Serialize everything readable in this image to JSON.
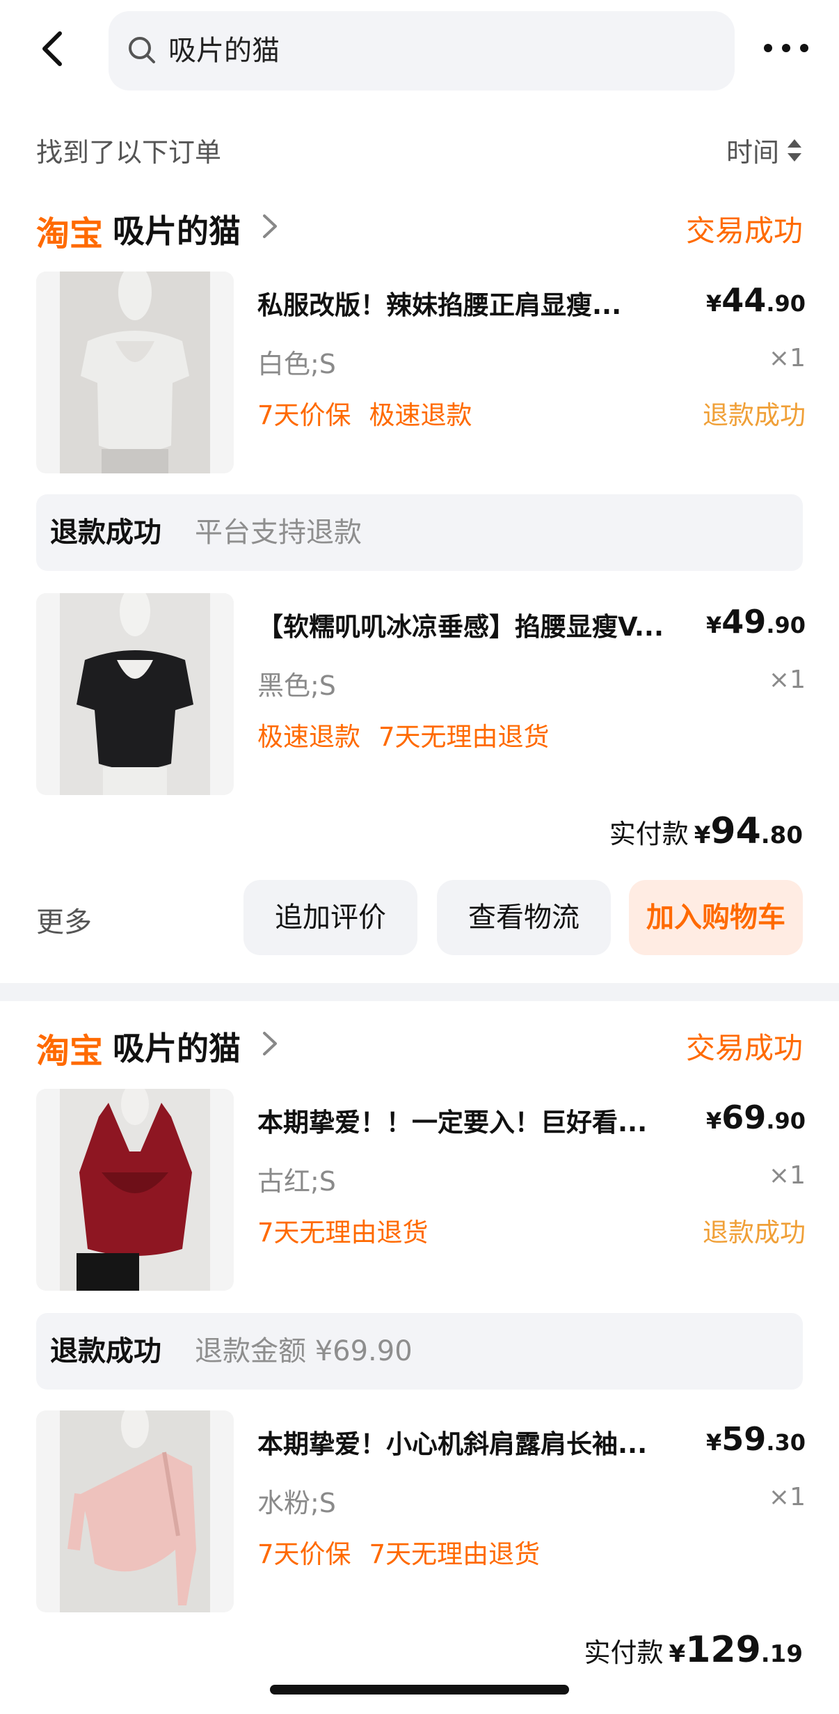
{
  "search": {
    "query": "吸片的猫"
  },
  "list": {
    "found_label": "找到了以下订单",
    "sort_label": "时间"
  },
  "orders": [
    {
      "platform": "淘宝",
      "shop": "吸片的猫",
      "status": "交易成功",
      "items": [
        {
          "title": "私服改版！辣妹掐腰正肩显瘦...",
          "price_cur": "¥",
          "price_int": "44",
          "price_dec": ".90",
          "sku": "白色;S",
          "qty": "×1",
          "tags": [
            "7天价保",
            "极速退款"
          ],
          "refund_status": "退款成功",
          "color": "#ededeb"
        },
        {
          "title": "【软糯叽叽冰凉垂感】掐腰显瘦V...",
          "price_cur": "¥",
          "price_int": "49",
          "price_dec": ".90",
          "sku": "黑色;S",
          "qty": "×1",
          "tags": [
            "极速退款",
            "7天无理由退货"
          ],
          "refund_status": "",
          "color": "#1d1d1f"
        }
      ],
      "refund_bar": {
        "title": "退款成功",
        "subtitle": "平台支持退款"
      },
      "paid": {
        "label": "实付款",
        "cur": "¥",
        "int": "94",
        "dec": ".80"
      },
      "actions": {
        "more": "更多",
        "review": "追加评价",
        "logistics": "查看物流",
        "cart": "加入购物车"
      }
    },
    {
      "platform": "淘宝",
      "shop": "吸片的猫",
      "status": "交易成功",
      "items": [
        {
          "title": "本期挚爱！！一定要入！巨好看...",
          "price_cur": "¥",
          "price_int": "69",
          "price_dec": ".90",
          "sku": "古红;S",
          "qty": "×1",
          "tags": [
            "7天无理由退货"
          ],
          "refund_status": "退款成功",
          "color": "#8e1622"
        },
        {
          "title": "本期挚爱！小心机斜肩露肩长袖...",
          "price_cur": "¥",
          "price_int": "59",
          "price_dec": ".30",
          "sku": "水粉;S",
          "qty": "×1",
          "tags": [
            "7天价保",
            "7天无理由退货"
          ],
          "refund_status": "",
          "color": "#eec2bd"
        }
      ],
      "refund_bar": {
        "title": "退款成功",
        "subtitle": "退款金额 ¥69.90"
      },
      "paid": {
        "label": "实付款",
        "cur": "¥",
        "int": "129",
        "dec": ".19"
      }
    }
  ]
}
